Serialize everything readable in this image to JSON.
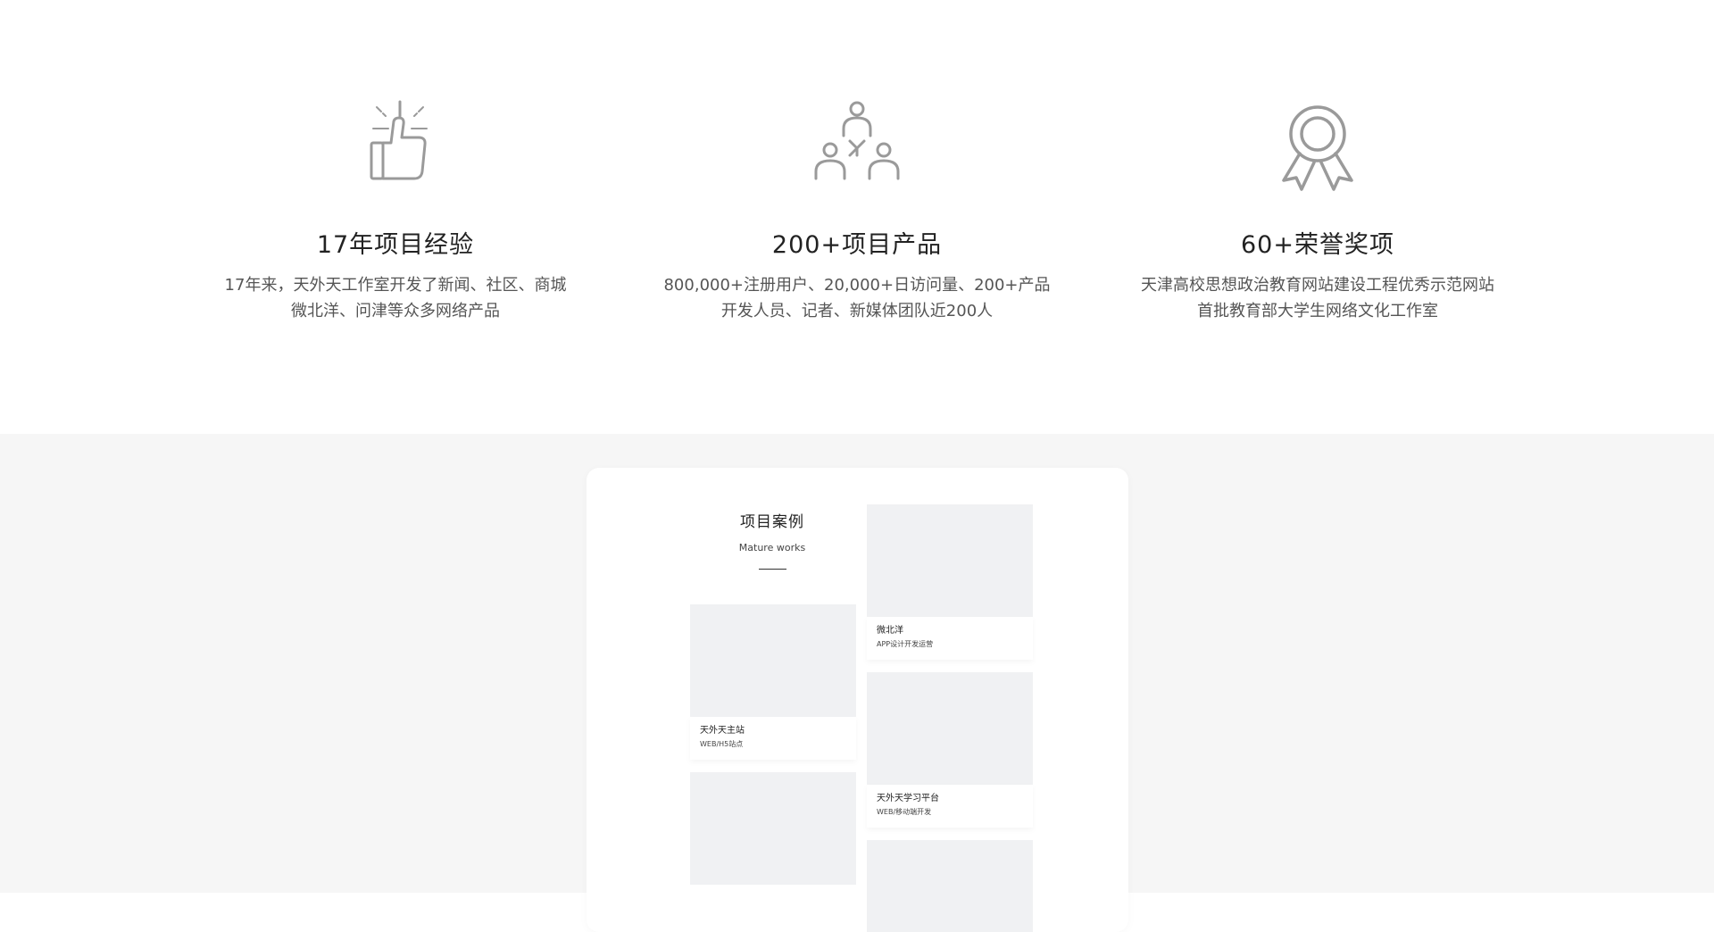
{
  "stats": [
    {
      "icon": "thumbs-up-icon",
      "title": "17年项目经验",
      "desc_line1": "17年来，天外天工作室开发了新闻、社区、商城",
      "desc_line2": "微北洋、问津等众多网络产品"
    },
    {
      "icon": "team-icon",
      "title": "200+项目产品",
      "desc_line1": "800,000+注册用户、20,000+日访问量、200+产品",
      "desc_line2": "开发人员、记者、新媒体团队近200人"
    },
    {
      "icon": "award-ribbon-icon",
      "title": "60+荣誉奖项",
      "desc_line1": "天津高校思想政治教育网站建设工程优秀示范网站",
      "desc_line2": "首批教育部大学生网络文化工作室"
    }
  ],
  "works": {
    "title": "项目案例",
    "subtitle": "Mature works",
    "items": [
      {
        "name": "微北洋",
        "sub": "APP设计开发运营"
      },
      {
        "name": "天外天主站",
        "sub": "WEB/H5站点"
      },
      {
        "name": "天外天学习平台",
        "sub": "WEB/移动端开发"
      },
      {
        "name": "",
        "sub": ""
      },
      {
        "name": "",
        "sub": ""
      }
    ]
  },
  "colors": {
    "icon_stroke": "#9a9a9a",
    "section_bg": "#f6f6f6",
    "placeholder": "#f0f1f3"
  }
}
